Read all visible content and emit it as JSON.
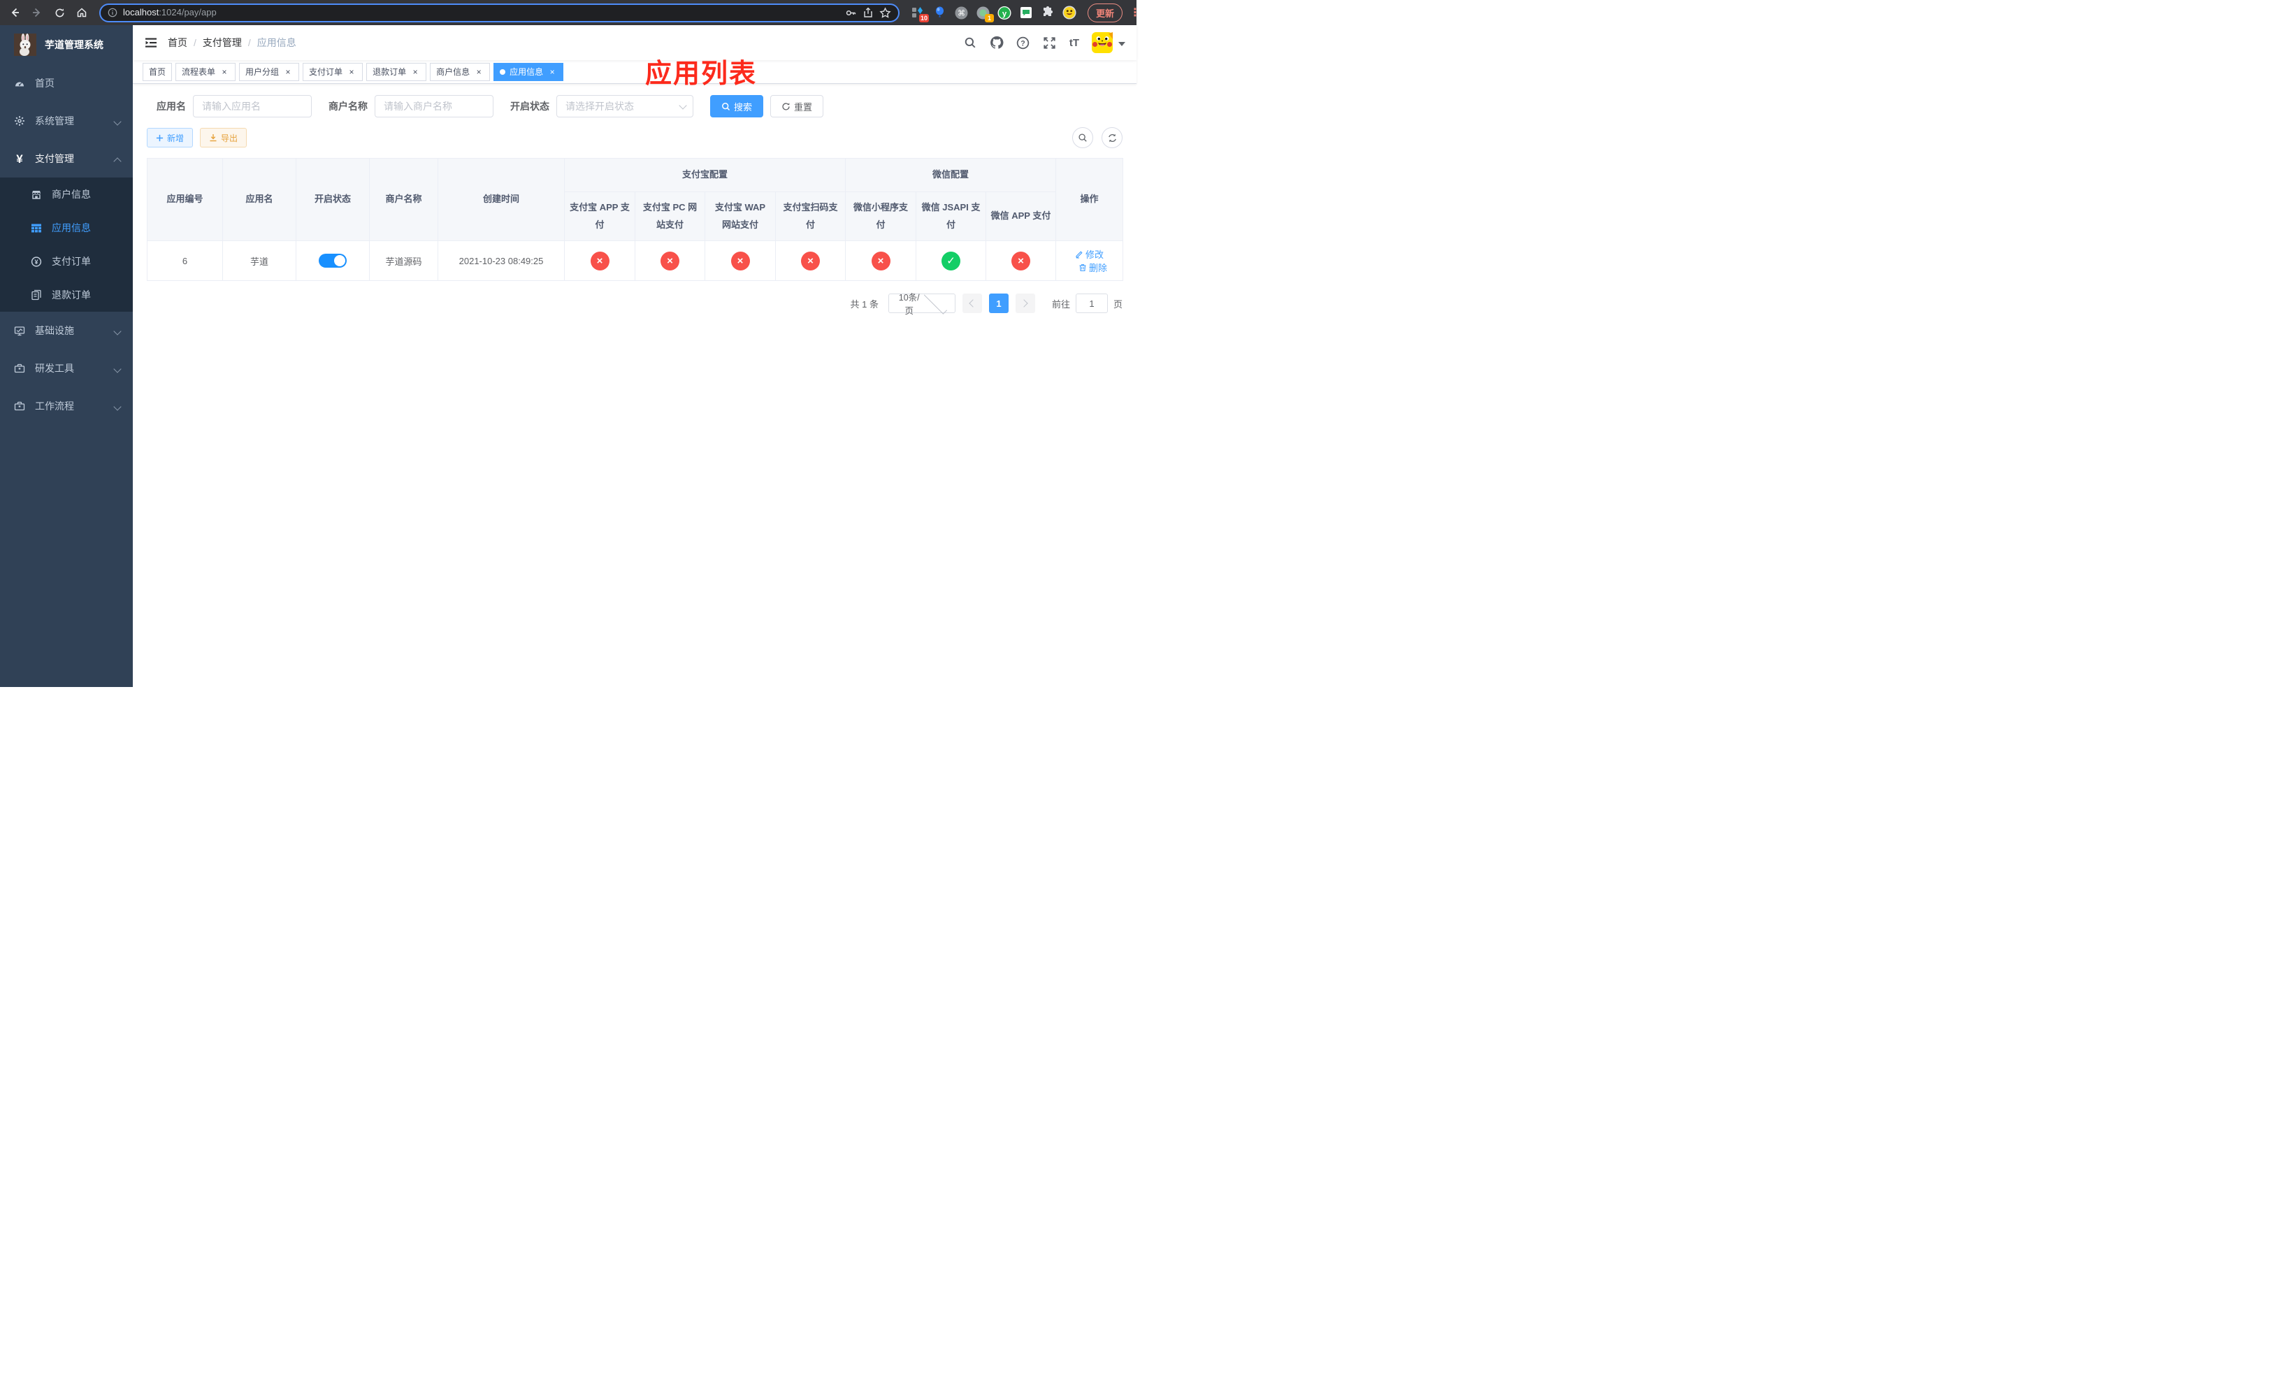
{
  "browser": {
    "url_host": "localhost",
    "url_rest": ":1024/pay/app",
    "update_label": "更新",
    "kebab": "⋮",
    "ext_badge_count_blue": "10",
    "ext_badge_count_green": "1",
    "command_glyph": "⌘",
    "y_glyph": "y"
  },
  "sidebar": {
    "logo_title": "芋道管理系统",
    "items_top": [
      {
        "label": "首页"
      },
      {
        "label": "系统管理"
      },
      {
        "label": "支付管理"
      }
    ],
    "submenu": [
      {
        "label": "商户信息"
      },
      {
        "label": "应用信息"
      },
      {
        "label": "支付订单"
      },
      {
        "label": "退款订单"
      }
    ],
    "items_bottom": [
      {
        "label": "基础设施"
      },
      {
        "label": "研发工具"
      },
      {
        "label": "工作流程"
      }
    ],
    "yen_glyph": "¥"
  },
  "navbar": {
    "breadcrumb": [
      "首页",
      "支付管理",
      "应用信息"
    ],
    "separator": "/",
    "overlay_title": "应用列表",
    "text_size_glyph": "tT",
    "question_glyph": "?"
  },
  "tabs": [
    {
      "label": "首页",
      "closable": false,
      "active": false
    },
    {
      "label": "流程表单",
      "closable": true,
      "active": false
    },
    {
      "label": "用户分组",
      "closable": true,
      "active": false
    },
    {
      "label": "支付订单",
      "closable": true,
      "active": false
    },
    {
      "label": "退款订单",
      "closable": true,
      "active": false
    },
    {
      "label": "商户信息",
      "closable": true,
      "active": false
    },
    {
      "label": "应用信息",
      "closable": true,
      "active": true
    }
  ],
  "icons": {
    "close": "×",
    "check": "✓"
  },
  "filters": {
    "app_name_label": "应用名",
    "app_name_placeholder": "请输入应用名",
    "merchant_label": "商户名称",
    "merchant_placeholder": "请输入商户名称",
    "status_label": "开启状态",
    "status_placeholder": "请选择开启状态",
    "search_label": "搜索",
    "reset_label": "重置"
  },
  "toolbar": {
    "add_label": "新增",
    "export_label": "导出"
  },
  "table": {
    "headers": {
      "app_id": "应用编号",
      "app_name": "应用名",
      "status": "开启状态",
      "merchant": "商户名称",
      "created": "创建时间",
      "group_alipay": "支付宝配置",
      "group_wechat": "微信配置",
      "alipay_cols": [
        "支付宝 APP 支付",
        "支付宝 PC 网站支付",
        "支付宝 WAP 网站支付",
        "支付宝扫码支付"
      ],
      "wechat_cols": [
        "微信小程序支付",
        "微信 JSAPI 支付",
        "微信 APP 支付"
      ],
      "action": "操作"
    },
    "rows": [
      {
        "id": "6",
        "name": "芋道",
        "enabled": true,
        "merchant": "芋道源码",
        "created": "2021-10-23 08:49:25",
        "statuses": [
          "no",
          "no",
          "no",
          "no",
          "no",
          "yes",
          "no"
        ],
        "edit_label": "修改",
        "delete_label": "删除"
      }
    ]
  },
  "pagination": {
    "total": "共 1 条",
    "page_size": "10条/页",
    "page": "1",
    "goto_label": "前往",
    "goto_value": "1",
    "page_suffix": "页"
  },
  "colors": {
    "accent": "#409eff",
    "danger": "#f8514a",
    "success": "#13ce66",
    "warning": "#e6a23c"
  }
}
